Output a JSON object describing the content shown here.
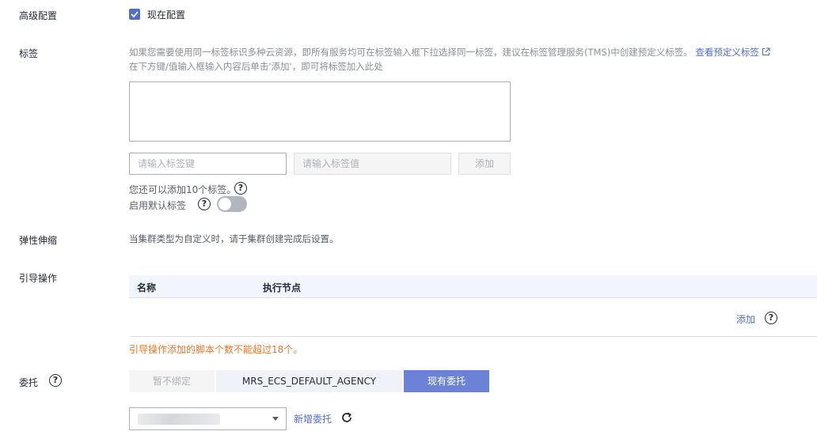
{
  "advanced": {
    "label": "高级配置",
    "checkbox_label": "现在配置",
    "checked": true
  },
  "tags": {
    "label": "标签",
    "desc_line1": "如果您需要使用同一标签标识多种云资源，即所有服务均可在标签输入框下拉选择同一标签，建议在标签管理服务(TMS)中创建预定义标签。",
    "view_link": "查看预定义标签",
    "desc_line2": "在下方键/值输入框输入内容后单击'添加'，即可将标签加入此处",
    "key_placeholder": "请输入标签键",
    "value_placeholder": "请输入标签值",
    "add_label": "添加",
    "remaining_text": "您还可以添加10个标签。",
    "default_tag_label": "启用默认标签",
    "default_tag_enabled": false
  },
  "scaling": {
    "label": "弹性伸缩",
    "text": "当集群类型为自定义时，请于集群创建完成后设置。"
  },
  "bootstrap": {
    "label": "引导操作",
    "columns": [
      "名称",
      "执行节点"
    ],
    "add_label": "添加",
    "warning": "引导操作添加的脚本个数不能超过18个。"
  },
  "agency": {
    "label": "委托",
    "options": [
      "暂不绑定",
      "MRS_ECS_DEFAULT_AGENCY",
      "现有委托"
    ],
    "selected": "现有委托",
    "new_link": "新增委托"
  },
  "icons": {
    "external": "external-link-icon",
    "help": "help-circle-icon",
    "refresh": "refresh-icon",
    "check": "check-icon",
    "caret": "chevron-down-icon"
  },
  "colors": {
    "primary": "#526ecc",
    "warning": "#e67a31"
  }
}
